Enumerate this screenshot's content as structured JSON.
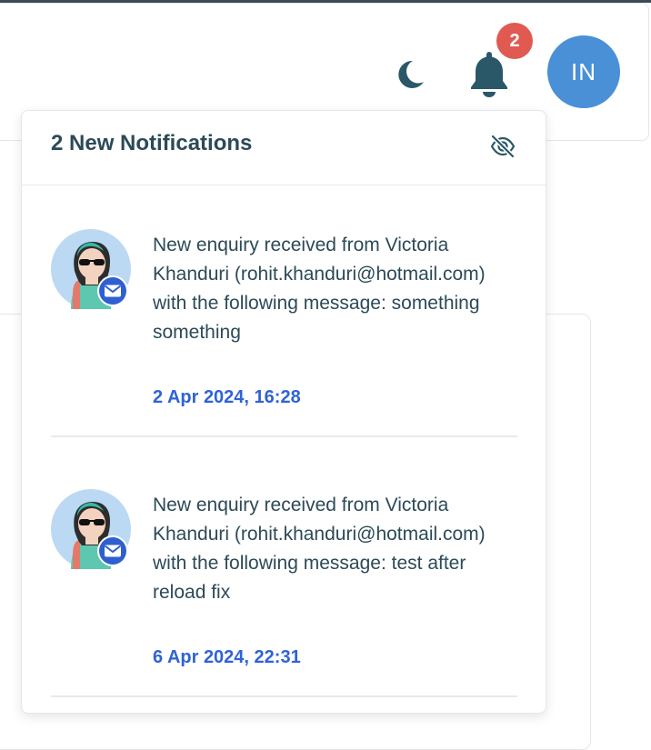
{
  "header": {
    "theme_icon": "moon-icon",
    "notifications_icon": "bell-icon",
    "notification_count": "2",
    "user_initials": "IN"
  },
  "panel": {
    "title": "2 New Notifications",
    "hide_icon": "eye-off-icon",
    "notifications": [
      {
        "message": "New enquiry received from Victoria Khanduri (rohit.khanduri@hotmail.com) with the following message: something something",
        "timestamp": "2 Apr 2024, 16:28",
        "type_icon": "mail-icon"
      },
      {
        "message": "New enquiry received from Victoria Khanduri (rohit.khanduri@hotmail.com) with the following message: test after reload fix",
        "timestamp": "6 Apr 2024, 22:31",
        "type_icon": "mail-icon"
      }
    ]
  },
  "colors": {
    "icon_dark": "#2a5868",
    "badge": "#e05a52",
    "avatar_bg": "#4a90d6",
    "timestamp": "#2f63d6",
    "text": "#2c4a57"
  }
}
